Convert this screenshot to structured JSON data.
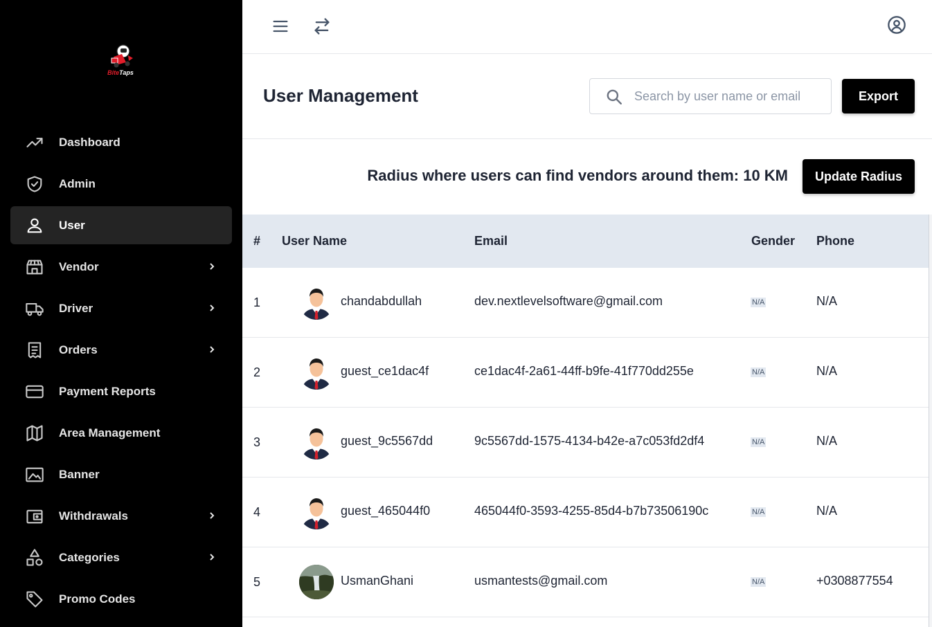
{
  "brand": {
    "logo_text_1": "Bite",
    "logo_text_2": "Taps"
  },
  "sidebar": {
    "items": [
      {
        "label": "Dashboard",
        "icon": "trending-up-icon",
        "has_submenu": false
      },
      {
        "label": "Admin",
        "icon": "shield-check-icon",
        "has_submenu": false
      },
      {
        "label": "User",
        "icon": "user-icon",
        "has_submenu": false,
        "active": true
      },
      {
        "label": "Vendor",
        "icon": "store-icon",
        "has_submenu": true
      },
      {
        "label": "Driver",
        "icon": "truck-icon",
        "has_submenu": true
      },
      {
        "label": "Orders",
        "icon": "receipt-icon",
        "has_submenu": true
      },
      {
        "label": "Payment Reports",
        "icon": "credit-card-icon",
        "has_submenu": false
      },
      {
        "label": "Area Management",
        "icon": "map-icon",
        "has_submenu": false
      },
      {
        "label": "Banner",
        "icon": "image-icon",
        "has_submenu": false
      },
      {
        "label": "Withdrawals",
        "icon": "wallet-icon",
        "has_submenu": true
      },
      {
        "label": "Categories",
        "icon": "shapes-icon",
        "has_submenu": true
      },
      {
        "label": "Promo Codes",
        "icon": "tag-icon",
        "has_submenu": false
      }
    ]
  },
  "topbar": {
    "menu_icon": "hamburger-menu-icon",
    "switch_icon": "swap-arrows-icon",
    "account_icon": "user-circle-icon"
  },
  "header": {
    "title": "User Management",
    "search_placeholder": "Search by user name or email",
    "search_value": "",
    "export_label": "Export"
  },
  "radius": {
    "text": "Radius where users can find vendors around them: 10 KM",
    "button_label": "Update Radius"
  },
  "table": {
    "columns": [
      "#",
      "User Name",
      "Email",
      "Gender",
      "Phone"
    ],
    "rows": [
      {
        "index": "1",
        "username": "chandabdullah",
        "email": "dev.nextlevelsoftware@gmail.com",
        "gender": "N/A",
        "phone": "N/A",
        "avatar": "default-avatar"
      },
      {
        "index": "2",
        "username": "guest_ce1dac4f",
        "email": "ce1dac4f-2a61-44ff-b9fe-41f770dd255e",
        "gender": "N/A",
        "phone": "N/A",
        "avatar": "default-avatar"
      },
      {
        "index": "3",
        "username": "guest_9c5567dd",
        "email": "9c5567dd-1575-4134-b42e-a7c053fd2df4",
        "gender": "N/A",
        "phone": "N/A",
        "avatar": "default-avatar"
      },
      {
        "index": "4",
        "username": "guest_465044f0",
        "email": "465044f0-3593-4255-85d4-b7b73506190c",
        "gender": "N/A",
        "phone": "N/A",
        "avatar": "default-avatar"
      },
      {
        "index": "5",
        "username": "UsmanGhani",
        "email": "usmantests@gmail.com",
        "gender": "N/A",
        "phone": "+0308877554",
        "avatar": "photo-avatar"
      }
    ]
  },
  "colors": {
    "sidebar_bg": "#000000",
    "active_item_bg": "#242424",
    "table_header_bg": "#e2e8f0",
    "button_bg": "#000000"
  }
}
